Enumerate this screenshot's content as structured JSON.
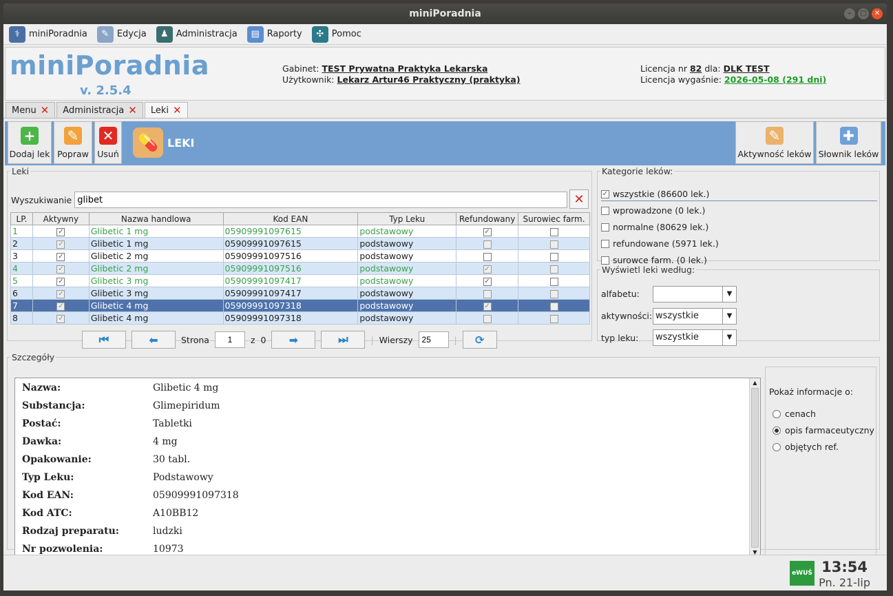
{
  "window": {
    "title": "miniPoradnia"
  },
  "menu": {
    "items": [
      {
        "label": "miniPoradnia",
        "icon": "doctor-icon",
        "color": "#4a6fa5"
      },
      {
        "label": "Edycja",
        "icon": "edit-icon",
        "color": "#8aa5c8"
      },
      {
        "label": "Administracja",
        "icon": "admin-icon",
        "color": "#3a6e6e"
      },
      {
        "label": "Raporty",
        "icon": "reports-icon",
        "color": "#5b8ed0"
      },
      {
        "label": "Pomoc",
        "icon": "help-icon",
        "color": "#2a7a8a"
      }
    ]
  },
  "header": {
    "logo": "miniPoradnia",
    "version": "v. 2.5.4",
    "gabinet_label": "Gabinet:",
    "gabinet_value": "TEST Prywatna Praktyka Lekarska",
    "user_label": "Użytkownik:",
    "user_value": "Lekarz Artur46 Praktyczny (praktyka)",
    "license_prefix": "Licencja nr",
    "license_nr": "82",
    "license_for": "dla:",
    "license_holder": "DLK TEST",
    "expires_label": "Licencja wygaśnie:",
    "expires_value": "2026-05-08 (291 dni)"
  },
  "tabs": [
    {
      "label": "Menu"
    },
    {
      "label": "Administracja"
    },
    {
      "label": "Leki",
      "active": true
    }
  ],
  "toolbar": {
    "add_label": "Dodaj lek",
    "edit_label": "Popraw",
    "delete_label": "Usuń",
    "section_title": "LEKI",
    "activity_label": "Aktywność leków",
    "dictionary_label": "Słownik leków"
  },
  "leki": {
    "legend": "Leki",
    "search_label": "Wyszukiwanie",
    "search_value": "glibet",
    "columns": [
      "LP.",
      "Aktywny",
      "Nazwa handlowa",
      "Kod EAN",
      "Typ Leku",
      "Refundowany",
      "Surowiec farm."
    ],
    "rows": [
      {
        "lp": "1",
        "name": "Glibetic 1 mg",
        "ean": "05909991097615",
        "type": "podstawowy",
        "active": true,
        "refund": true,
        "raw": false,
        "inactive": true,
        "alt": false
      },
      {
        "lp": "2",
        "name": "Glibetic 1 mg",
        "ean": "05909991097615",
        "type": "podstawowy",
        "active": true,
        "refund": false,
        "raw": false,
        "inactive": false,
        "alt": true
      },
      {
        "lp": "3",
        "name": "Glibetic 2 mg",
        "ean": "05909991097516",
        "type": "podstawowy",
        "active": true,
        "refund": false,
        "raw": false,
        "inactive": false,
        "alt": false
      },
      {
        "lp": "4",
        "name": "Glibetic 2 mg",
        "ean": "05909991097516",
        "type": "podstawowy",
        "active": true,
        "refund": true,
        "raw": false,
        "inactive": true,
        "alt": true
      },
      {
        "lp": "5",
        "name": "Glibetic 3 mg",
        "ean": "05909991097417",
        "type": "podstawowy",
        "active": true,
        "refund": true,
        "raw": false,
        "inactive": true,
        "alt": false
      },
      {
        "lp": "6",
        "name": "Glibetic 3 mg",
        "ean": "05909991097417",
        "type": "podstawowy",
        "active": true,
        "refund": false,
        "raw": false,
        "inactive": false,
        "alt": true
      },
      {
        "lp": "7",
        "name": "Glibetic 4 mg",
        "ean": "05909991097318",
        "type": "podstawowy",
        "active": true,
        "refund": true,
        "raw": false,
        "inactive": true,
        "alt": false,
        "selected": true
      },
      {
        "lp": "8",
        "name": "Glibetic 4 mg",
        "ean": "05909991097318",
        "type": "podstawowy",
        "active": true,
        "refund": false,
        "raw": false,
        "inactive": false,
        "alt": true
      }
    ],
    "pager": {
      "page_label": "Strona",
      "page": "1",
      "of_label": "z",
      "total": "0",
      "rows_label": "Wierszy",
      "rows": "25"
    }
  },
  "categories": {
    "legend": "Kategorie leków:",
    "items": [
      {
        "label": "wszystkie (86600 lek.)",
        "checked": true
      },
      {
        "label": "wprowadzone (0 lek.)",
        "checked": false
      },
      {
        "label": "normalne (80629 lek.)",
        "checked": false
      },
      {
        "label": "refundowane (5971 lek.)",
        "checked": false
      },
      {
        "label": "surowce farm. (0 lek.)",
        "checked": false
      }
    ]
  },
  "display": {
    "legend": "Wyświetl leki według:",
    "alfabetu_label": "alfabetu:",
    "alfabetu_value": "",
    "aktywnosci_label": "aktywności:",
    "aktywnosci_value": "wszystkie",
    "typ_label": "typ leku:",
    "typ_value": "wszystkie"
  },
  "details": {
    "legend": "Szczegóły",
    "rows": [
      {
        "label": "Nazwa:",
        "value": "Glibetic 4 mg"
      },
      {
        "label": "Substancja:",
        "value": "Glimepiridum"
      },
      {
        "label": "Postać:",
        "value": "Tabletki"
      },
      {
        "label": "Dawka:",
        "value": "4 mg"
      },
      {
        "label": "Opakowanie:",
        "value": "30 tabl."
      },
      {
        "label": "Typ Leku:",
        "value": "Podstawowy"
      },
      {
        "label": "Kod EAN:",
        "value": "05909991097318"
      },
      {
        "label": "Kod ATC:",
        "value": "A10BB12"
      },
      {
        "label": "Rodzaj preparatu:",
        "value": "ludzki"
      },
      {
        "label": "Nr pozwolenia:",
        "value": "10973"
      }
    ],
    "info_label": "Pokaż informacje o:",
    "options": [
      {
        "label": "cenach",
        "selected": false
      },
      {
        "label": "opis farmaceutyczny",
        "selected": true
      },
      {
        "label": "objętych ref.",
        "selected": false
      }
    ]
  },
  "status": {
    "badge": "eWUŚ",
    "time": "13:54",
    "date": "Pn. 21-lip"
  }
}
